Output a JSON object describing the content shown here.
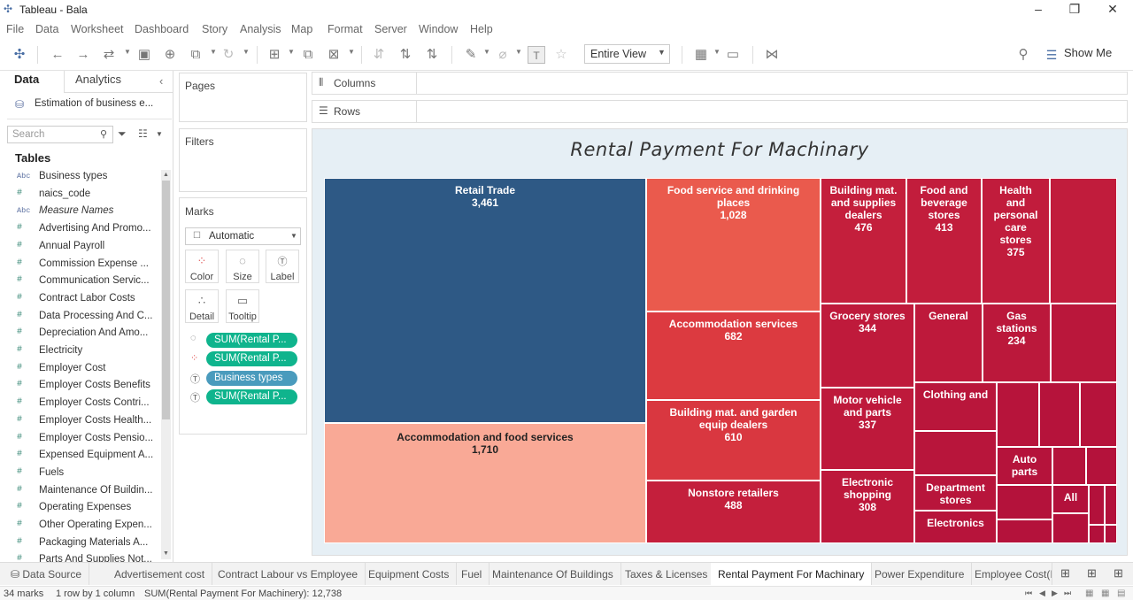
{
  "window": {
    "title": "Tableau - Bala",
    "minimize": "–",
    "restore": "❐",
    "close": "✕"
  },
  "menu": [
    "File",
    "Data",
    "Worksheet",
    "Dashboard",
    "Story",
    "Analysis",
    "Map",
    "Format",
    "Server",
    "Window",
    "Help"
  ],
  "toolbar": {
    "view_select": "Entire View",
    "show_me": "Show Me"
  },
  "data_pane": {
    "tab_data": "Data",
    "tab_analytics": "Analytics",
    "datasource": "Estimation of business e...",
    "search_placeholder": "Search",
    "tables_heading": "Tables",
    "fields": [
      {
        "icon": "Abc",
        "name": "Business types"
      },
      {
        "icon": "#",
        "name": "naics_code"
      },
      {
        "icon": "Abc",
        "name": "Measure Names"
      },
      {
        "icon": "#",
        "name": "Advertising And Promo..."
      },
      {
        "icon": "#",
        "name": "Annual Payroll"
      },
      {
        "icon": "#",
        "name": "Commission Expense ..."
      },
      {
        "icon": "#",
        "name": "Communication Servic..."
      },
      {
        "icon": "#",
        "name": "Contract Labor Costs"
      },
      {
        "icon": "#",
        "name": "Data Processing And C..."
      },
      {
        "icon": "#",
        "name": "Depreciation And Amo..."
      },
      {
        "icon": "#",
        "name": "Electricity"
      },
      {
        "icon": "#",
        "name": "Employer Cost"
      },
      {
        "icon": "#",
        "name": "Employer Costs Benefits"
      },
      {
        "icon": "#",
        "name": "Employer Costs Contri..."
      },
      {
        "icon": "#",
        "name": "Employer Costs Health..."
      },
      {
        "icon": "#",
        "name": "Employer Costs Pensio..."
      },
      {
        "icon": "#",
        "name": "Expensed Equipment A..."
      },
      {
        "icon": "#",
        "name": "Fuels"
      },
      {
        "icon": "#",
        "name": "Maintenance Of Buildin..."
      },
      {
        "icon": "#",
        "name": "Operating Expenses"
      },
      {
        "icon": "#",
        "name": "Other Operating Expen..."
      },
      {
        "icon": "#",
        "name": "Packaging Materials A..."
      },
      {
        "icon": "#",
        "name": "Parts And Supplies Not..."
      }
    ]
  },
  "cards": {
    "pages": "Pages",
    "filters": "Filters",
    "marks": "Marks",
    "mark_type": "Automatic",
    "buttons": [
      "Color",
      "Size",
      "Label",
      "Detail",
      "Tooltip"
    ],
    "pills": [
      "SUM(Rental P...",
      "SUM(Rental P...",
      "Business types",
      "SUM(Rental P..."
    ]
  },
  "shelves": {
    "columns": "Columns",
    "rows": "Rows"
  },
  "viz": {
    "title": "Rental Payment For Machinary",
    "tiles": [
      {
        "label": "Retail Trade",
        "value": "3,461",
        "color": "#2e5985"
      },
      {
        "label": "Accommodation and food services",
        "value": "1,710",
        "color": "#f9a996",
        "dark": true
      },
      {
        "label": "Food service and drinking places",
        "value": "1,028",
        "color": "#ea5a4d"
      },
      {
        "label": "Accommodation services",
        "value": "682",
        "color": "#dc3a40"
      },
      {
        "label": "Building mat. and garden equip dealers",
        "value": "610",
        "color": "#d93740"
      },
      {
        "label": "Nonstore retailers",
        "value": "488",
        "color": "#c41f3c"
      },
      {
        "label": "Building mat. and supplies dealers",
        "value": "476",
        "color": "#c41f3c"
      },
      {
        "label": "Food and beverage stores",
        "value": "413",
        "color": "#c21d3c"
      },
      {
        "label": "Health and personal care stores",
        "value": "375",
        "color": "#c11c3c"
      },
      {
        "label": "",
        "value": "",
        "color": "#c11c3c"
      },
      {
        "label": "Grocery stores",
        "value": "344",
        "color": "#bf1a3b"
      },
      {
        "label": "General",
        "value": "",
        "color": "#be193b"
      },
      {
        "label": "Gas stations",
        "value": "234",
        "color": "#bb183b"
      },
      {
        "label": "",
        "value": "",
        "color": "#ba173b"
      },
      {
        "label": "Motor vehicle and parts",
        "value": "337",
        "color": "#be193b"
      },
      {
        "label": "Electronic shopping",
        "value": "308",
        "color": "#bd183b"
      },
      {
        "label": "Clothing and",
        "value": "",
        "color": "#b9163b"
      },
      {
        "label": "",
        "value": "",
        "color": "#b8153b"
      },
      {
        "label": "Department stores",
        "value": "",
        "color": "#b8153b"
      },
      {
        "label": "Electronics",
        "value": "",
        "color": "#b7143b"
      },
      {
        "label": "",
        "value": "",
        "color": "#b7143b"
      },
      {
        "label": "",
        "value": "",
        "color": "#b6133b"
      },
      {
        "label": "",
        "value": "",
        "color": "#b6133b"
      },
      {
        "label": "Auto parts",
        "value": "",
        "color": "#b5133b"
      },
      {
        "label": "",
        "value": "",
        "color": "#b5133b"
      },
      {
        "label": "",
        "value": "",
        "color": "#b4123b"
      },
      {
        "label": "",
        "value": "",
        "color": "#b4123b"
      },
      {
        "label": "",
        "value": "",
        "color": "#b4123b"
      },
      {
        "label": "All",
        "value": "",
        "color": "#b3113b"
      },
      {
        "label": "",
        "value": "",
        "color": "#b3113b"
      },
      {
        "label": "",
        "value": "",
        "color": "#b3113b"
      },
      {
        "label": "",
        "value": "",
        "color": "#b3113b"
      },
      {
        "label": "",
        "value": "",
        "color": "#b2103b"
      },
      {
        "label": "",
        "value": "",
        "color": "#b2103b"
      }
    ]
  },
  "sheets": [
    "Data Source",
    "Advertisement cost",
    "Contract Labour vs Employee",
    "Equipment Costs",
    "Fuel",
    "Maintenance Of Buildings",
    "Taxes & Licenses",
    "Rental Payment For Machinary",
    "Power Expenditure",
    "Employee Cost(Ir"
  ],
  "active_sheet": "Rental Payment For Machinary",
  "status": {
    "marks": "34 marks",
    "dims": "1 row by 1 column",
    "sum": "SUM(Rental Payment For Machinery): 12,738"
  }
}
